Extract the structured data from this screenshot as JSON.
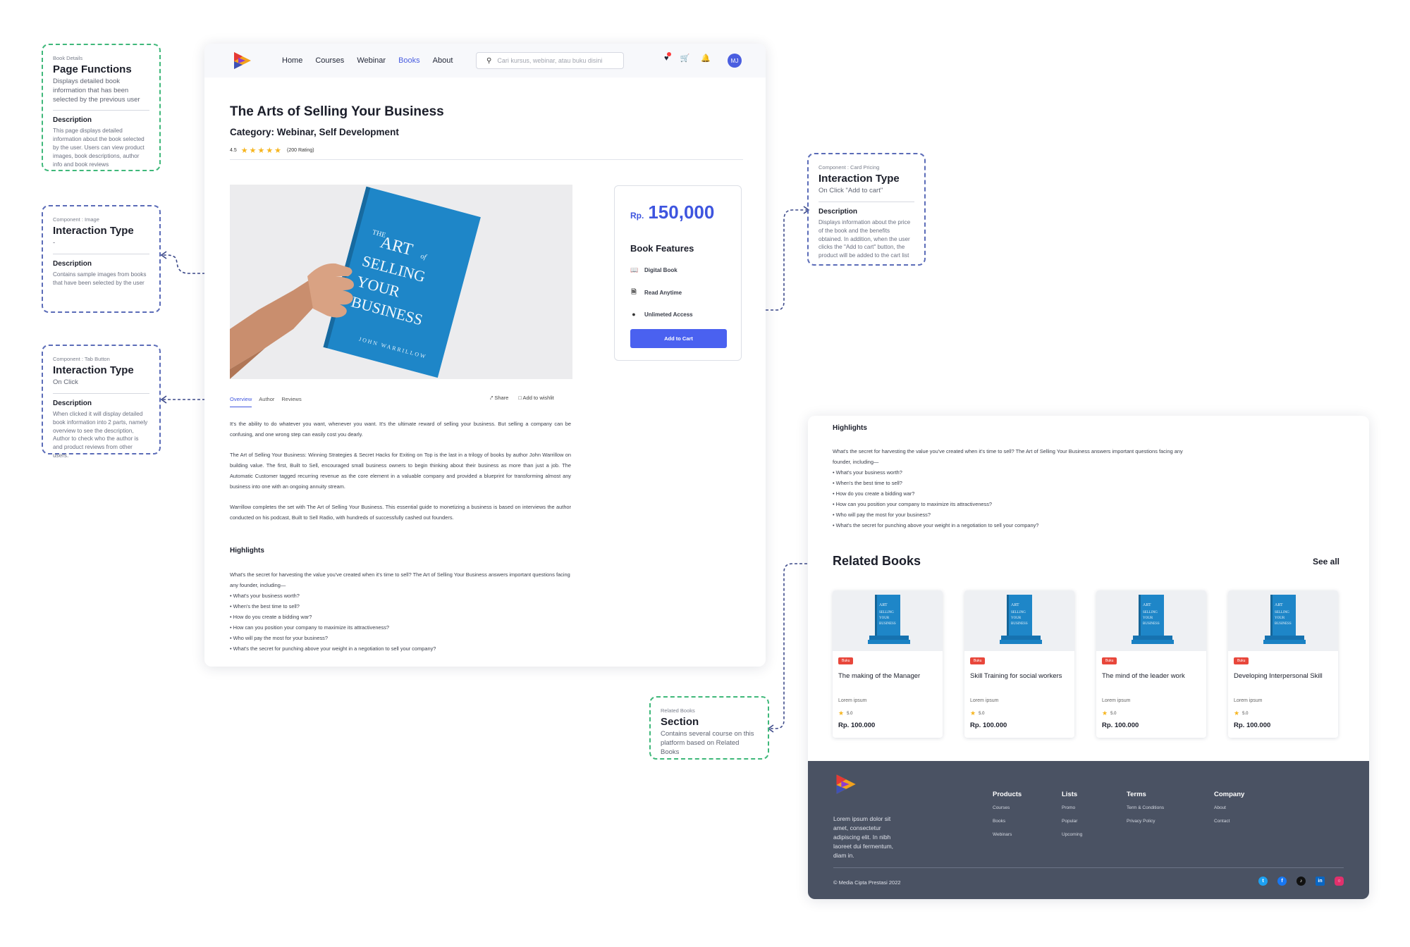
{
  "annotations": {
    "page_functions": {
      "tag": "Book Details",
      "title": "Page Functions",
      "subtitle": "Displays detailed book information that has been selected by the previous user",
      "desc_label": "Description",
      "desc": "This page displays detailed information about the book selected by the user. Users can view product images, book descriptions, author info and book reviews"
    },
    "image": {
      "tag": "Component : Image",
      "title": "Interaction Type",
      "subtitle": "-",
      "desc_label": "Description",
      "desc": "Contains sample images from books that have been selected by the user"
    },
    "tab_button": {
      "tag": "Component : Tab Button",
      "title": "Interaction Type",
      "subtitle": "On Click",
      "desc_label": "Description",
      "desc": "When clicked it will display detailed book information into 2 parts, namely overview to see the description, Author to check who the author is and product reviews from other users."
    },
    "card_pricing": {
      "tag": "Component : Card Pricing",
      "title": "Interaction Type",
      "subtitle": "On Click \"Add to cart\"",
      "desc_label": "Description",
      "desc": "Displays information about the price of the book and the benefits obtained. In addition, when the user clicks the \"Add to cart\" button, the product will be added to the cart list"
    },
    "related_books": {
      "tag": "Related Books",
      "title": "Section",
      "subtitle": "Contains several course on this platform based on Related Books"
    }
  },
  "nav": {
    "links": [
      "Home",
      "Courses",
      "Webinar",
      "Books",
      "About"
    ],
    "active": "Books",
    "search_placeholder": "Cari kursus, webinar, atau buku disini",
    "avatar_initials": "MJ"
  },
  "book": {
    "title": "The Arts of Selling Your Business",
    "category": "Category: Webinar, Self Development",
    "rating": "4.5",
    "rating_count": "(200 Rating)",
    "stars_value": 5,
    "cover_lines": [
      "THE",
      "ART",
      "of",
      "SELLING",
      "YOUR",
      "BUSINESS",
      "JOHN WARRILLOW"
    ]
  },
  "pricing": {
    "currency": "Rp.",
    "amount": "150,000",
    "features_title": "Book Features",
    "features": [
      {
        "icon": "book-icon",
        "label": "Digital Book"
      },
      {
        "icon": "document-icon",
        "label": "Read Anytime"
      },
      {
        "icon": "infinity-icon",
        "label": "Unlimeted Access"
      }
    ],
    "button": "Add to Cart"
  },
  "tabs": {
    "items": [
      "Overview",
      "Author",
      "Reviews"
    ],
    "active": "Overview",
    "share": "Share",
    "wishlist": "Add to wishlit"
  },
  "overview": {
    "paragraphs": [
      "It's the ability to do whatever you want, whenever you want. It's the ultimate reward of selling your business. But selling a company can be confusing, and one wrong step can easily cost you dearly.",
      "The Art of Selling Your Business: Winning Strategies & Secret Hacks for Exiting on Top is the last in a trilogy of books by author John Warrillow on building value. The first, Built to Sell, encouraged small business owners to begin thinking about their business as more than just a job. The Automatic Customer tagged recurring revenue as the core element in a valuable company and provided a blueprint for transforming almost any business into one with an ongoing annuity stream.",
      "Warrillow completes the set with The Art of Selling Your Business. This essential guide to monetizing a business is based on interviews the author conducted on his podcast, Built to Sell Radio, with hundreds of successfully cashed out founders."
    ]
  },
  "highlights": {
    "title": "Highlights",
    "intro": "What's the secret for harvesting the value you've created when it's time to sell? The Art of Selling Your Business answers important questions facing any founder, including—",
    "bullets": [
      "• What's your business worth?",
      "• When's the best time to sell?",
      "• How do you create a bidding war?",
      "• How can you position your company to maximize its attractiveness?",
      "• Who will pay the most for your business?",
      "• What's the secret for punching above your weight in a negotiation to sell your company?"
    ]
  },
  "related": {
    "title": "Related Books",
    "see_all": "See all",
    "items": [
      {
        "badge": "Buku",
        "name": "The making of the Manager",
        "sub": "Lorem ipsum",
        "rating": "5.0",
        "price": "Rp. 100.000"
      },
      {
        "badge": "Buku",
        "name": "Skill Training for social workers",
        "sub": "Lorem ipsum",
        "rating": "5.0",
        "price": "Rp. 100.000"
      },
      {
        "badge": "Buku",
        "name": "The mind of the leader work",
        "sub": "Lorem ipsum",
        "rating": "5.0",
        "price": "Rp. 100.000"
      },
      {
        "badge": "Buku",
        "name": "Developing Interpersonal Skill",
        "sub": "Lorem ipsum",
        "rating": "5.0",
        "price": "Rp. 100.000"
      }
    ]
  },
  "footer": {
    "about": "Lorem ipsum dolor sit amet, consectetur adipiscing elit. In nibh laoreet dui fermentum, diam in.",
    "columns": [
      {
        "title": "Products",
        "links": [
          "Courses",
          "Books",
          "Webinars"
        ]
      },
      {
        "title": "Lists",
        "links": [
          "Promo",
          "Popular",
          "Upcoming"
        ]
      },
      {
        "title": "Terms",
        "links": [
          "Term & Conditions",
          "Privacy Policy"
        ]
      },
      {
        "title": "Company",
        "links": [
          "About",
          "Contact"
        ]
      }
    ],
    "copyright": "© Media Cipta Prestasi 2022",
    "socials": [
      "twitter-icon",
      "facebook-icon",
      "tiktok-icon",
      "linkedin-icon",
      "instagram-icon"
    ]
  },
  "colors": {
    "accent": "#4a61f0",
    "price": "#3e55df",
    "footer_bg": "#4a5263",
    "badge": "#e8473b",
    "star": "#f6b51e",
    "anno_green": "#3fb87a",
    "anno_blue": "#5b6cb8"
  }
}
